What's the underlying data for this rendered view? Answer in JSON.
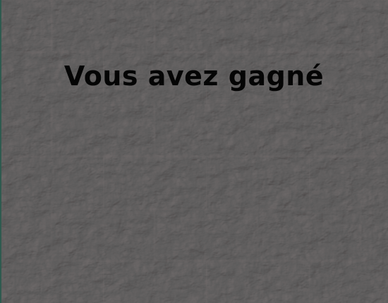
{
  "screen": {
    "message": "Vous avez gagné"
  },
  "colors": {
    "background": "#545151",
    "stone_highlight": "#8a8686",
    "stone_shadow": "#2e2c2c",
    "message_text": "#050505",
    "left_edge": "#2f5a4f"
  }
}
